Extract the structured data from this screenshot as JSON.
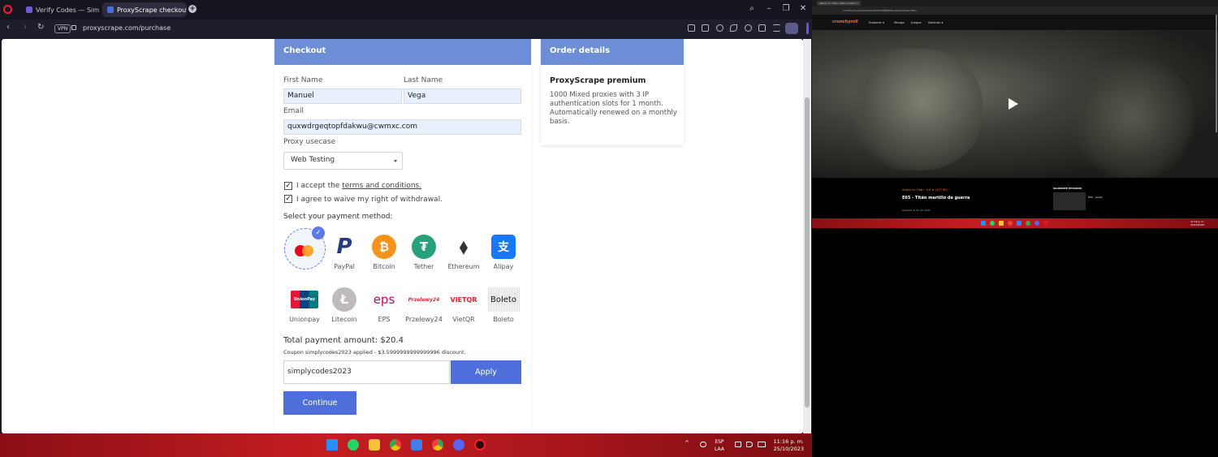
{
  "browser": {
    "tabs": [
      {
        "label": "Verify Codes — SimplyCo"
      },
      {
        "label": "ProxyScrape checkout"
      }
    ],
    "new_tab": "+",
    "vpn": "VPN",
    "url": "proxyscrape.com/purchase"
  },
  "checkout": {
    "header": "Checkout",
    "first_name_label": "First Name",
    "first_name": "Manuel",
    "last_name_label": "Last Name",
    "last_name": "Vega",
    "email_label": "Email",
    "email": "quxwdrgeqtopfdakwu@cwmxc.com",
    "usecase_label": "Proxy usecase",
    "usecase_value": "Web Testing",
    "terms_prefix": "I accept the ",
    "terms_link": "terms and conditions.",
    "withdrawal_text": "I agree to waive my right of withdrawal.",
    "payment_title": "Select your payment method:",
    "payment_methods": [
      {
        "label": "PayPal",
        "glyph": "P",
        "color": "#ffffff"
      },
      {
        "label": "Bitcoin",
        "glyph": "₿",
        "color": "#f7931a"
      },
      {
        "label": "Tether",
        "glyph": "₮",
        "color": "#26a17b"
      },
      {
        "label": "Ethereum",
        "glyph": "◆",
        "color": "#ffffff"
      },
      {
        "label": "Alipay",
        "glyph": "支",
        "color": "#1677ff"
      },
      {
        "label": "Unionpay",
        "glyph": "UnionPay",
        "color": "#ffffff"
      },
      {
        "label": "Litecoin",
        "glyph": "Ł",
        "color": "#bfbbbb"
      },
      {
        "label": "EPS",
        "glyph": "eps",
        "color": "#ffffff"
      },
      {
        "label": "Przelewy24",
        "glyph": "Przelewy24",
        "color": "#ffffff"
      },
      {
        "label": "VietQR",
        "glyph": "VIETQR",
        "color": "#ffffff"
      },
      {
        "label": "Boleto",
        "glyph": "Boleto",
        "color": "#ffffff"
      }
    ],
    "selected_check": "✓",
    "total": "Total payment amount: $20.4",
    "coupon_note": "Coupon simplycodes2023 applied - $3.5999999999999996 discount.",
    "coupon_value": "simplycodes2023",
    "apply_label": "Apply",
    "continue_label": "Continue"
  },
  "order": {
    "header": "Order details",
    "product": "ProxyScrape premium",
    "description": "1000 Mixed proxies with 3 IP authentication slots for 1 month. Automatically renewed on a monthly basis."
  },
  "taskbar": {
    "lang": "ESP",
    "lang2": "LAA",
    "time": "11:16 p. m.",
    "date": "25/10/2023"
  },
  "right_screen": {
    "tab_title": "Attack on Titan: Titán martillo d",
    "url": "crunchyroll.com/es/watch/G31UXJ98X/the-war-hammer-titan",
    "logo": "crunchyroll",
    "nav": [
      "Explorar ▾",
      "Manga",
      "Juegos",
      "Noticias ▾"
    ],
    "series": "Attack on Titan · 4.8 ★ (177.9K) ›",
    "episode_title": "E65 - Titán martillo de guerra",
    "episode_date": "Lanzado el 21 dic 2021",
    "next_label": "SIGUIENTE EPISODIO",
    "next_title": "E66 - Asalto",
    "clock": "11:16 p. m.\n25/10/2023"
  },
  "colors": {
    "accent": "#4e6fdb",
    "card_header": "#6d8ed6",
    "taskbar": "#c51d22",
    "crunchyroll": "#f47521"
  }
}
